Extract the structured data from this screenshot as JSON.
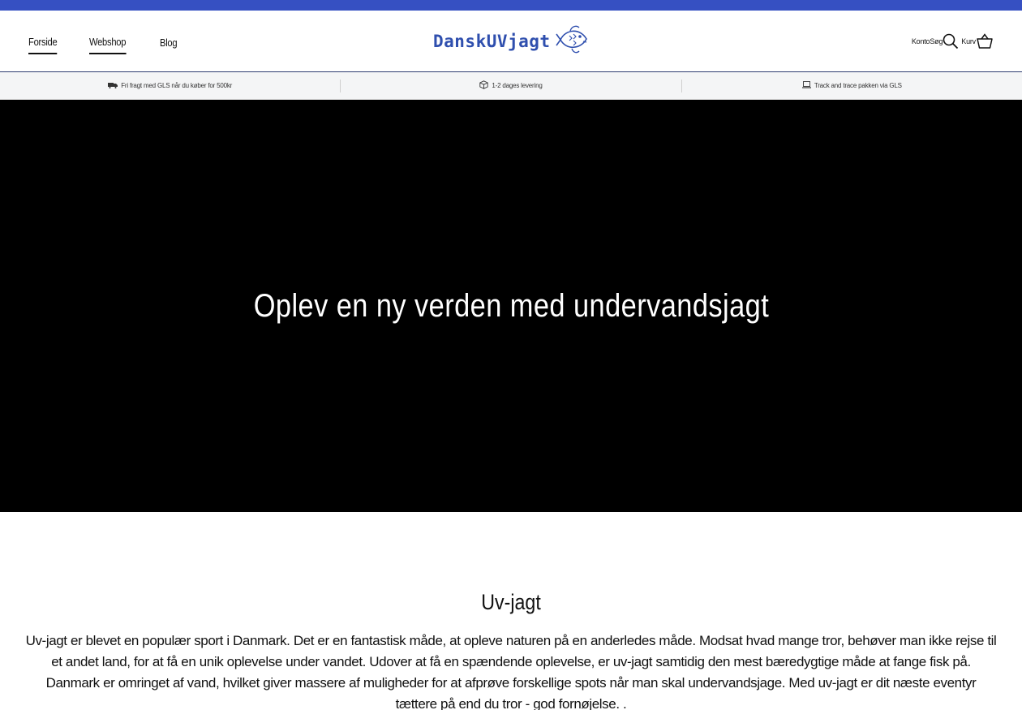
{
  "colors": {
    "topbar": "#3650c2",
    "brand": "#2f4fae",
    "hero_bg": "#000000"
  },
  "nav": {
    "items": [
      {
        "label": "Forside"
      },
      {
        "label": "Webshop"
      },
      {
        "label": "Blog"
      }
    ]
  },
  "logo": {
    "text": "DanskUVjagt",
    "icon": "fish-icon"
  },
  "header_right": {
    "account_label": "Konto",
    "search_label": "Søg",
    "search_icon": "search-icon",
    "cart_label": "Kurv",
    "cart_icon": "basket-icon"
  },
  "usp": [
    {
      "icon": "truck-icon",
      "text": "Fri fragt med GLS når du køber for 500kr"
    },
    {
      "icon": "box-icon",
      "text": "1-2 dages levering"
    },
    {
      "icon": "laptop-icon",
      "text": "Track and trace pakken via GLS"
    }
  ],
  "hero": {
    "heading": "Oplev en ny verden med undervandsjagt"
  },
  "content": {
    "title": "Uv-jagt",
    "body": "Uv-jagt er blevet en populær sport i Danmark. Det er en fantastisk måde, at opleve naturen på en anderledes måde. Modsat hvad mange tror, behøver man ikke rejse til et andet land, for at få en unik oplevelse under vandet. Udover at få en spændende oplevelse, er uv-jagt samtidig den mest bæredygtige måde at fange fisk på. Danmark er omringet af vand, hvilket giver massere af muligheder for at afprøve forskellige spots når man skal undervandsjage. Med uv-jagt er dit næste eventyr tættere på end du tror - god fornøjelse. ."
  }
}
